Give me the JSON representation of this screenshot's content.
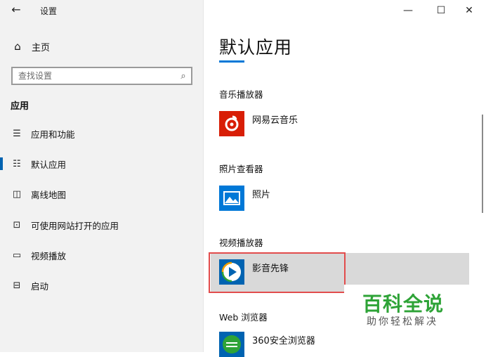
{
  "window": {
    "title": "设置",
    "back_icon": "arrow-left-icon",
    "minimize_icon": "minimize-icon",
    "maximize_icon": "maximize-icon",
    "close_icon": "close-icon"
  },
  "sidebar": {
    "home_label": "主页",
    "search_placeholder": "查找设置",
    "section_title": "应用",
    "items": [
      {
        "label": "应用和功能",
        "icon": "apps-list-icon"
      },
      {
        "label": "默认应用",
        "icon": "default-apps-icon"
      },
      {
        "label": "离线地图",
        "icon": "offline-maps-icon"
      },
      {
        "label": "可使用网站打开的应用",
        "icon": "open-in-website-icon"
      },
      {
        "label": "视频播放",
        "icon": "video-playback-icon"
      },
      {
        "label": "启动",
        "icon": "startup-icon"
      }
    ],
    "active_item": "默认应用"
  },
  "main": {
    "title": "默认应用",
    "categories": [
      {
        "label": "音乐播放器",
        "app": "网易云音乐",
        "color": "#d81e06"
      },
      {
        "label": "照片查看器",
        "app": "照片",
        "color": "#0078d7"
      },
      {
        "label": "视频播放器",
        "app": "影音先锋",
        "color": "#0063b1"
      },
      {
        "label": "Web 浏览器",
        "app": "360安全浏览器",
        "color": "#2ea337"
      }
    ]
  },
  "watermark": {
    "big": "百科全说",
    "small": "助你轻松解决"
  },
  "colors": {
    "accent": "#0078d7",
    "highlight_border": "#e24c4c",
    "watermark_green": "#2ea337"
  }
}
